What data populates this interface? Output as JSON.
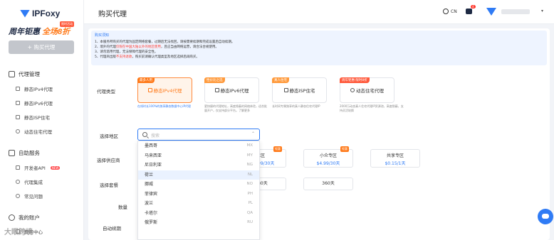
{
  "colors": {
    "accent": "#2f7bf5",
    "orange": "#ff7a1a",
    "active_bg": "#fff4ea",
    "danger": "#ff3b30"
  },
  "sidebar": {
    "logo": "IPFoxy",
    "promo_line1": "周年钜惠",
    "promo_line2": "全场8折",
    "promo_tag": "限时活动",
    "buy_button": "+ 购买代理",
    "section_proxy": "代理管理",
    "proxy_items": [
      "静态IPv4代理",
      "静态IPv6代理",
      "静态ISP住宅",
      "动态住宅代理"
    ],
    "section_self": "自助服务",
    "self_items": [
      "开发者API",
      "代理集成",
      "常见问题"
    ],
    "new_badge": "NEW",
    "section_account": "我的账户",
    "account_item": "费用中心"
  },
  "header": {
    "title": "购买代理",
    "lang": "CN",
    "notif_count": "4"
  },
  "notice": {
    "title": "购买须知",
    "l1": "1、本服务所购买的代理为固定网络套餐，过期后无法找回，请按需要续期和完成设置后自动续期。",
    "l2a": "2、境外的代理",
    "l2r": "仅限在中国大陆以外的地区使用",
    "l2b": "，且应当由网络运营，请合法合规使用。",
    "l3": "3、请勿滥用代理，无法保障代理的安全性。",
    "l4a": "5、代理商出版",
    "l4r": "不支持退款",
    "l4b": "，购买前请确认代理类型及地区选择后再购买。"
  },
  "labels": {
    "type": "代理类型",
    "region": "选择地区",
    "supplier": "选择供应商",
    "period": "选择套餐",
    "qty": "数量",
    "autorenew": "自动续期"
  },
  "types": [
    {
      "tag": "最多人用",
      "name": "静态IPv4代理",
      "desc": "在线时长100%的独享静态数据中心IP代理"
    },
    {
      "tag": "性价比之选",
      "name": "静态IPv6代理",
      "desc": "更快捷的代理地址，高度隐蔽的网络体验，适合批量开户，仅支持部分平台。了解更多"
    },
    {
      "tag": "真人住宅",
      "name": "静态ISP住宅",
      "desc": "长时间专属独享的真人静态住宅代理IP"
    },
    {
      "tag": "周年钜惠·限时8折",
      "name": "动态住宅代理",
      "desc": "2000万动态真人住宅代理IP资源池，高度隐蔽，支持灵活轮换"
    }
  ],
  "region_dropdown": {
    "placeholder": "搜索",
    "options": [
      {
        "name": "墨西哥",
        "code": "MX"
      },
      {
        "name": "马来西亚",
        "code": "MY"
      },
      {
        "name": "尼日利亚",
        "code": "NG"
      },
      {
        "name": "荷兰",
        "code": "NL"
      },
      {
        "name": "挪威",
        "code": "NO"
      },
      {
        "name": "菲律宾",
        "code": "PH"
      },
      {
        "name": "波兰",
        "code": "PL"
      },
      {
        "name": "卡塔尔",
        "code": "QA"
      },
      {
        "name": "俄罗斯",
        "code": "RU"
      }
    ]
  },
  "suppliers": [
    {
      "name": "C区",
      "price": "$12.99/30天",
      "tag": "钜惠"
    },
    {
      "name": "小众专区",
      "price": "$4.99/30天",
      "tag": "钜惠"
    },
    {
      "name": "共享专区",
      "price": "$0.15/1天",
      "tag": ""
    }
  ],
  "periods": [
    "180天",
    "360天"
  ],
  "watermark": "大眼跨境"
}
